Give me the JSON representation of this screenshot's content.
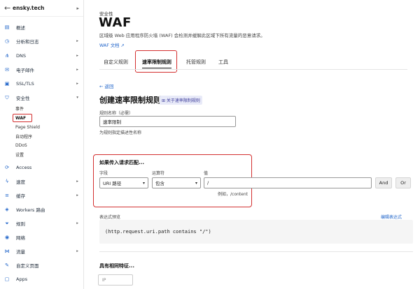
{
  "sidebar": {
    "site": "ensky.tech",
    "items": [
      {
        "label": "概述",
        "icon": "document-icon",
        "arrow": ""
      },
      {
        "label": "分析和日志",
        "icon": "clock-icon",
        "arrow": "▸"
      },
      {
        "label": "DNS",
        "icon": "network-icon",
        "arrow": "▸"
      },
      {
        "label": "电子邮件",
        "icon": "envelope-icon",
        "arrow": "▸"
      },
      {
        "label": "SSL/TLS",
        "icon": "lock-icon",
        "arrow": "▸"
      },
      {
        "label": "安全性",
        "icon": "shield-icon",
        "arrow": "▾"
      },
      {
        "label": "Access",
        "icon": "access-icon",
        "arrow": ""
      },
      {
        "label": "速度",
        "icon": "bolt-icon",
        "arrow": "▸"
      },
      {
        "label": "缓存",
        "icon": "stack-icon",
        "arrow": "▸"
      },
      {
        "label": "Workers 路由",
        "icon": "workers-icon",
        "arrow": ""
      },
      {
        "label": "规则",
        "icon": "funnel-icon",
        "arrow": "▸"
      },
      {
        "label": "网络",
        "icon": "pin-icon",
        "arrow": ""
      },
      {
        "label": "流量",
        "icon": "share-icon",
        "arrow": "▸"
      },
      {
        "label": "自定义页面",
        "icon": "wrench-icon",
        "arrow": ""
      },
      {
        "label": "Apps",
        "icon": "apps-icon",
        "arrow": ""
      }
    ],
    "security_sub": [
      "事件",
      "WAF",
      "Page Shield",
      "自动程序",
      "DDoS",
      "设置"
    ]
  },
  "main": {
    "breadcrumb": "安全性",
    "title": "WAF",
    "description": "区域级 Web 应用程序防火墙 (WAF) 会检测并缓解此区域下所有流量的恶意请求。",
    "doc_link": "WAF 文档 ↗",
    "tabs": [
      "自定义规则",
      "速率限制规则",
      "托管规则",
      "工具"
    ],
    "back": "← 返回",
    "heading": "创建速率限制规则",
    "badge": "⊞ 关于速率限制规则",
    "rule_name_label": "规则名称（必需）",
    "rule_name_value": "速率限制",
    "rule_name_hint": "为规则指定描述性名称",
    "match_title": "如果传入请求匹配...",
    "field_label": "字段",
    "operator_label": "运算符",
    "value_label": "值",
    "field_value": "URI 路径",
    "operator_value": "包含",
    "value_value": "/",
    "value_hint": "例如，/content",
    "and_btn": "And",
    "or_btn": "Or",
    "expr_label": "表达式预览",
    "edit_expr": "编辑表达式",
    "expr": "(http.request.uri.path contains \"/\")",
    "same_char": "具有相同特征...",
    "ip_option": "IP"
  },
  "colors": {
    "accent": "#1e63c9",
    "highlight": "#d32f2f"
  }
}
